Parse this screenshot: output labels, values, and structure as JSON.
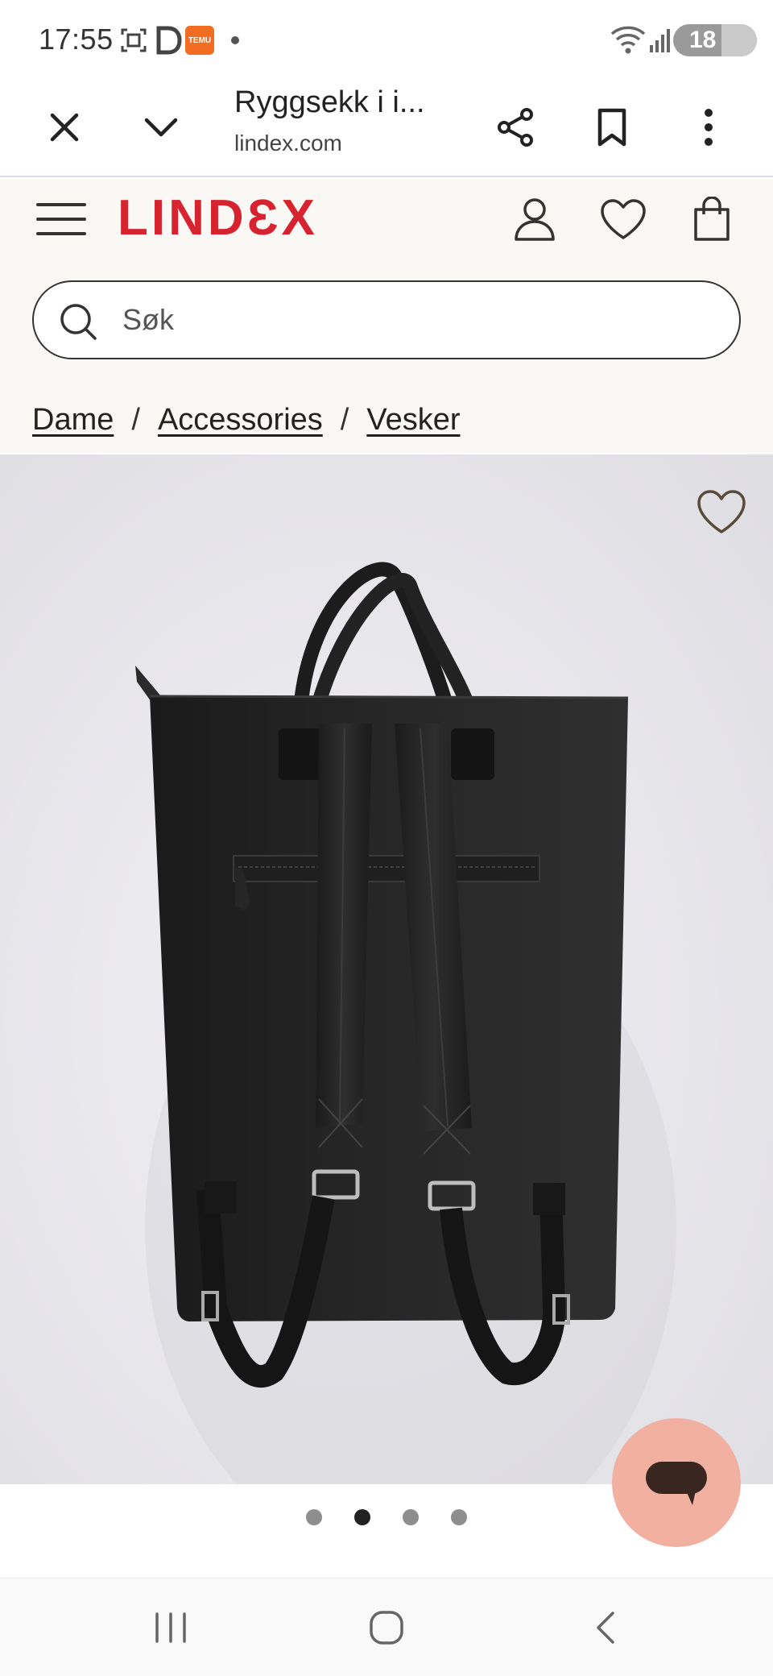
{
  "status_bar": {
    "time": "17:55",
    "temu_label": "TEMU",
    "battery": "18"
  },
  "browser": {
    "page_title": "Ryggsekk i i...",
    "url": "lindex.com",
    "icons": [
      "close-icon",
      "chevron-down-icon",
      "share-icon",
      "bookmark-icon",
      "more-vert-icon"
    ]
  },
  "site": {
    "logo": "LINDƐX",
    "brand_color": "#d6232f",
    "search_placeholder": "Søk",
    "header_icons": [
      "menu-icon",
      "user-icon",
      "heart-icon",
      "bag-icon"
    ]
  },
  "breadcrumb": [
    {
      "label": "Dame"
    },
    {
      "label": "Accessories"
    },
    {
      "label": "Vesker"
    }
  ],
  "breadcrumb_separator": "/",
  "carousel": {
    "total": 4,
    "active_index": 1
  },
  "chat": {
    "icon": "chat-bubble-icon",
    "color": "#f2b0a0"
  },
  "nav": {
    "icons": [
      "recent-apps-icon",
      "home-icon",
      "back-icon"
    ]
  }
}
